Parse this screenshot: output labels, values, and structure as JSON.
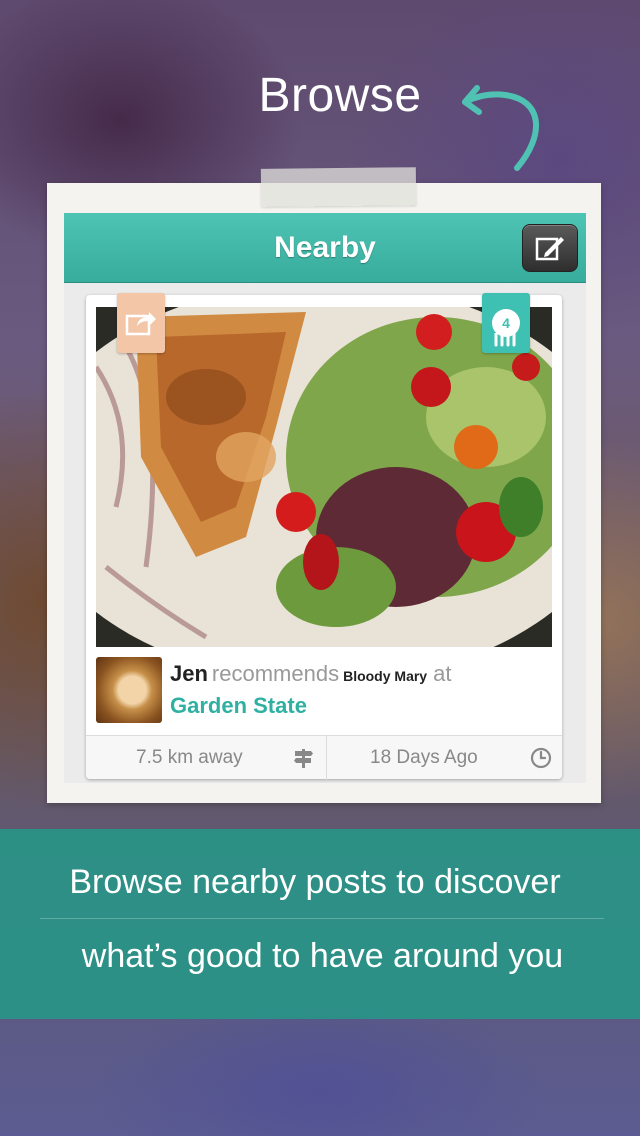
{
  "heading": "Browse",
  "nav": {
    "title": "Nearby"
  },
  "post": {
    "user_name": "Jen",
    "verb": "recommends",
    "item": "Bloody Mary",
    "connector": "at",
    "place": "Garden State",
    "count_badge": "4",
    "distance": "7.5 km away",
    "time_ago": "18 Days Ago"
  },
  "caption": {
    "line1": "Browse nearby posts to discover",
    "line2": "what’s good to have around you"
  },
  "icons": {
    "arrow": "curved-arrow-icon",
    "compose": "compose-icon",
    "share": "share-icon",
    "signpost": "signpost-icon",
    "clock": "clock-icon"
  },
  "colors": {
    "accent": "#3ec0b2",
    "place_text": "#2fb0a1",
    "share_badge": "#f3c6a7",
    "banner": "#28968a"
  }
}
